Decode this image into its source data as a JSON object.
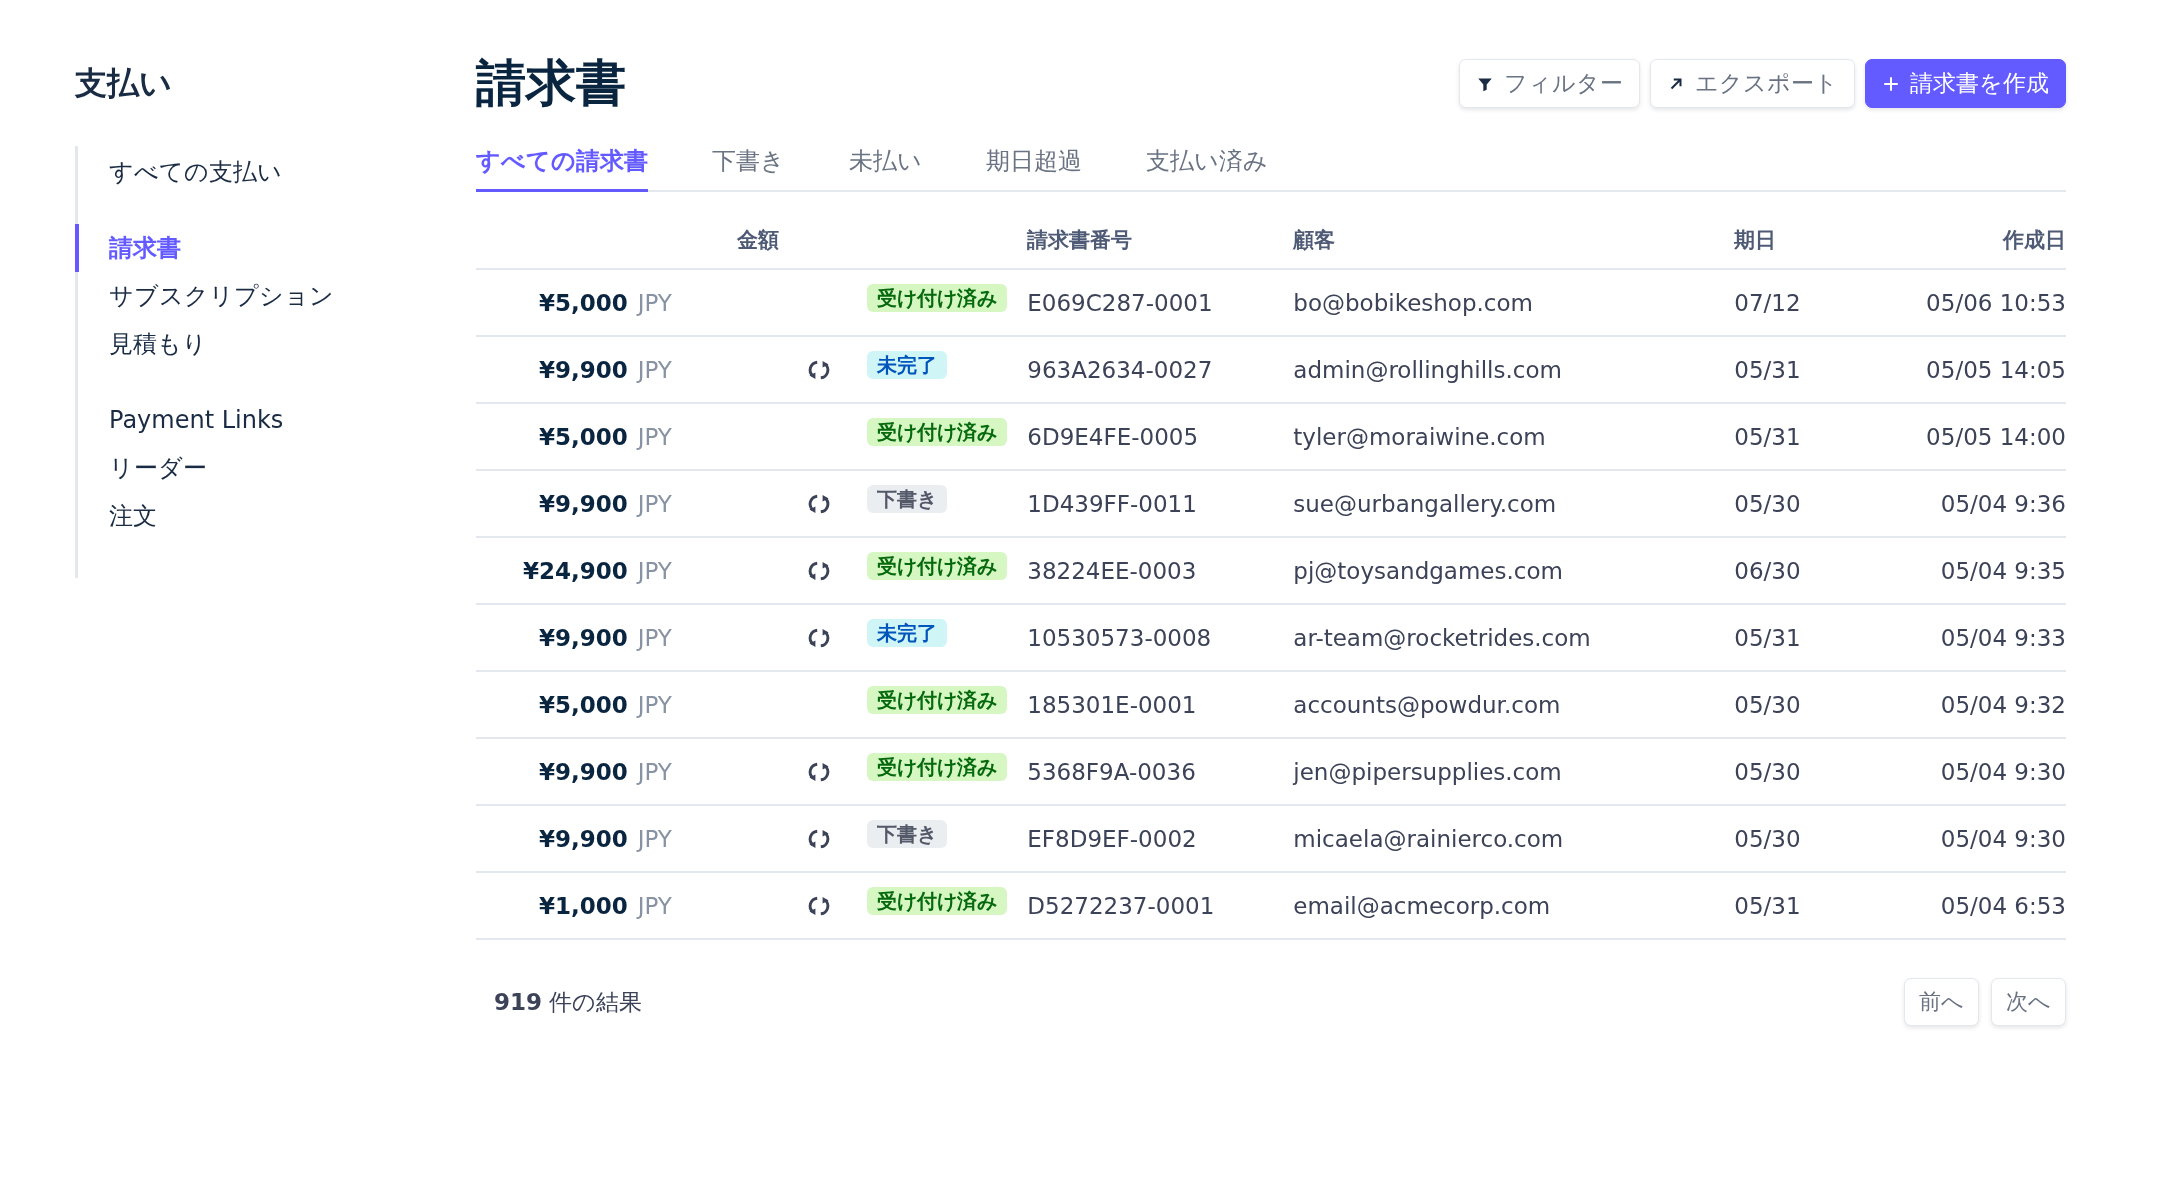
{
  "sidebar": {
    "title": "支払い",
    "groups": [
      [
        {
          "label": "すべての支払い",
          "selected": false
        }
      ],
      [
        {
          "label": "請求書",
          "selected": true
        },
        {
          "label": "サブスクリプション",
          "selected": false
        },
        {
          "label": "見積もり",
          "selected": false
        }
      ],
      [
        {
          "label": "Payment Links",
          "selected": false
        },
        {
          "label": "リーダー",
          "selected": false
        },
        {
          "label": "注文",
          "selected": false
        }
      ]
    ]
  },
  "page": {
    "title": "請求書",
    "actions": [
      {
        "label": "フィルター",
        "kind": "filter"
      },
      {
        "label": "エクスポート",
        "kind": "export"
      },
      {
        "label": "請求書を作成",
        "kind": "create"
      }
    ]
  },
  "tabs": [
    {
      "label": "すべての請求書",
      "selected": true
    },
    {
      "label": "下書き",
      "selected": false
    },
    {
      "label": "未払い",
      "selected": false
    },
    {
      "label": "期日超過",
      "selected": false
    },
    {
      "label": "支払い済み",
      "selected": false
    }
  ],
  "table": {
    "columns": [
      "金額",
      "請求書番号",
      "顧客",
      "期日",
      "作成日"
    ],
    "rows": [
      {
        "amount": "¥5,000",
        "currency": "JPY",
        "recurring": false,
        "status": {
          "label": "受け付け済み",
          "kind": "paid"
        },
        "number": "E069C287-0001",
        "customer": "bo@bobikeshop.com",
        "due": "07/12",
        "created": "05/06 10:53"
      },
      {
        "amount": "¥9,900",
        "currency": "JPY",
        "recurring": true,
        "status": {
          "label": "未完了",
          "kind": "open"
        },
        "number": "963A2634-0027",
        "customer": "admin@rollinghills.com",
        "due": "05/31",
        "created": "05/05 14:05"
      },
      {
        "amount": "¥5,000",
        "currency": "JPY",
        "recurring": false,
        "status": {
          "label": "受け付け済み",
          "kind": "paid"
        },
        "number": "6D9E4FE-0005",
        "customer": "tyler@moraiwine.com",
        "due": "05/31",
        "created": "05/05 14:00"
      },
      {
        "amount": "¥9,900",
        "currency": "JPY",
        "recurring": true,
        "status": {
          "label": "下書き",
          "kind": "draft"
        },
        "number": "1D439FF-0011",
        "customer": "sue@urbangallery.com",
        "due": "05/30",
        "created": "05/04 9:36"
      },
      {
        "amount": "¥24,900",
        "currency": "JPY",
        "recurring": true,
        "status": {
          "label": "受け付け済み",
          "kind": "paid"
        },
        "number": "38224EE-0003",
        "customer": "pj@toysandgames.com",
        "due": "06/30",
        "created": "05/04 9:35"
      },
      {
        "amount": "¥9,900",
        "currency": "JPY",
        "recurring": true,
        "status": {
          "label": "未完了",
          "kind": "open"
        },
        "number": "10530573-0008",
        "customer": "ar-team@rocketrides.com",
        "due": "05/31",
        "created": "05/04 9:33"
      },
      {
        "amount": "¥5,000",
        "currency": "JPY",
        "recurring": false,
        "status": {
          "label": "受け付け済み",
          "kind": "paid"
        },
        "number": "185301E-0001",
        "customer": "accounts@powdur.com",
        "due": "05/30",
        "created": "05/04 9:32"
      },
      {
        "amount": "¥9,900",
        "currency": "JPY",
        "recurring": true,
        "status": {
          "label": "受け付け済み",
          "kind": "paid"
        },
        "number": "5368F9A-0036",
        "customer": "jen@pipersupplies.com",
        "due": "05/30",
        "created": "05/04 9:30"
      },
      {
        "amount": "¥9,900",
        "currency": "JPY",
        "recurring": true,
        "status": {
          "label": "下書き",
          "kind": "draft"
        },
        "number": "EF8D9EF-0002",
        "customer": "micaela@rainierco.com",
        "due": "05/30",
        "created": "05/04 9:30"
      },
      {
        "amount": "¥1,000",
        "currency": "JPY",
        "recurring": true,
        "status": {
          "label": "受け付け済み",
          "kind": "paid"
        },
        "number": "D5272237-0001",
        "customer": "email@acmecorp.com",
        "due": "05/31",
        "created": "05/04 6:53"
      }
    ]
  },
  "footer": {
    "result_count": "**919** 件の結果",
    "buttons": [
      "前へ",
      "次へ"
    ]
  }
}
